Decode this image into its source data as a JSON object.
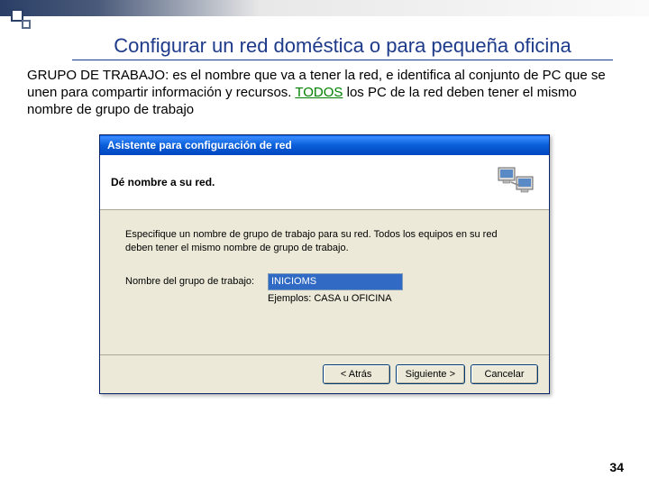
{
  "slide": {
    "title": "Configurar un red doméstica o para pequeña oficina",
    "body_prefix": "GRUPO DE TRABAJO: es el nombre que va a tener la red, e identifica al conjunto de PC que se unen para compartir información y recursos. ",
    "body_todos": "TODOS",
    "body_suffix": " los PC de la red deben tener el mismo nombre de grupo de trabajo",
    "page_number": "34"
  },
  "dialog": {
    "title": "Asistente para configuración de red",
    "header": "Dé nombre a su red.",
    "instruction": "Especifique un nombre de grupo de trabajo para su red. Todos los equipos en su red deben tener el mismo nombre de grupo de trabajo.",
    "label": "Nombre del grupo de trabajo:",
    "value": "INICIOMS",
    "examples": "Ejemplos: CASA u OFICINA",
    "buttons": {
      "back": "< Atrás",
      "next": "Siguiente >",
      "cancel": "Cancelar"
    }
  }
}
